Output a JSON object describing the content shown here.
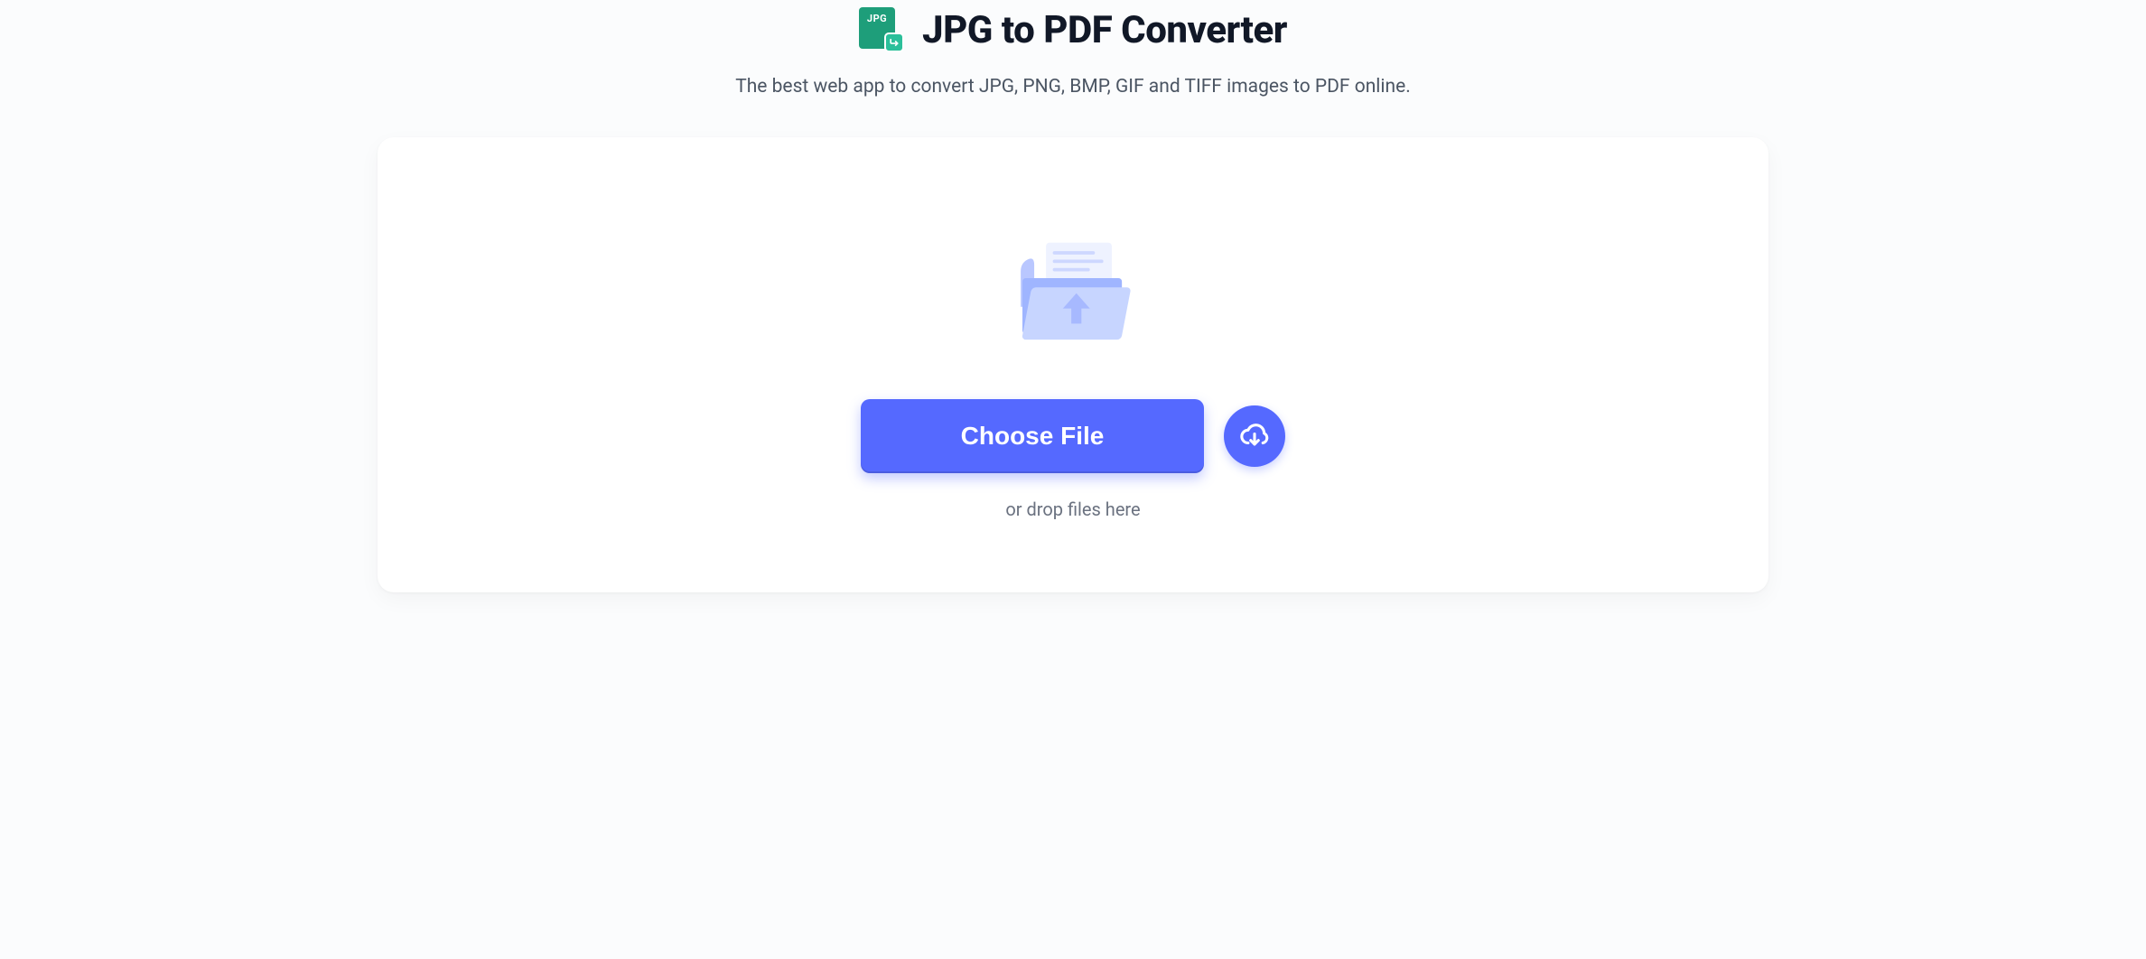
{
  "header": {
    "icon_tag": "JPG",
    "title": "JPG to PDF Converter",
    "subtitle": "The best web app to convert JPG, PNG, BMP, GIF and TIFF images to PDF online."
  },
  "upload": {
    "choose_label": "Choose File",
    "drop_hint": "or drop files here"
  },
  "colors": {
    "accent": "#5569ff",
    "icon_green": "#1e9e7a"
  }
}
